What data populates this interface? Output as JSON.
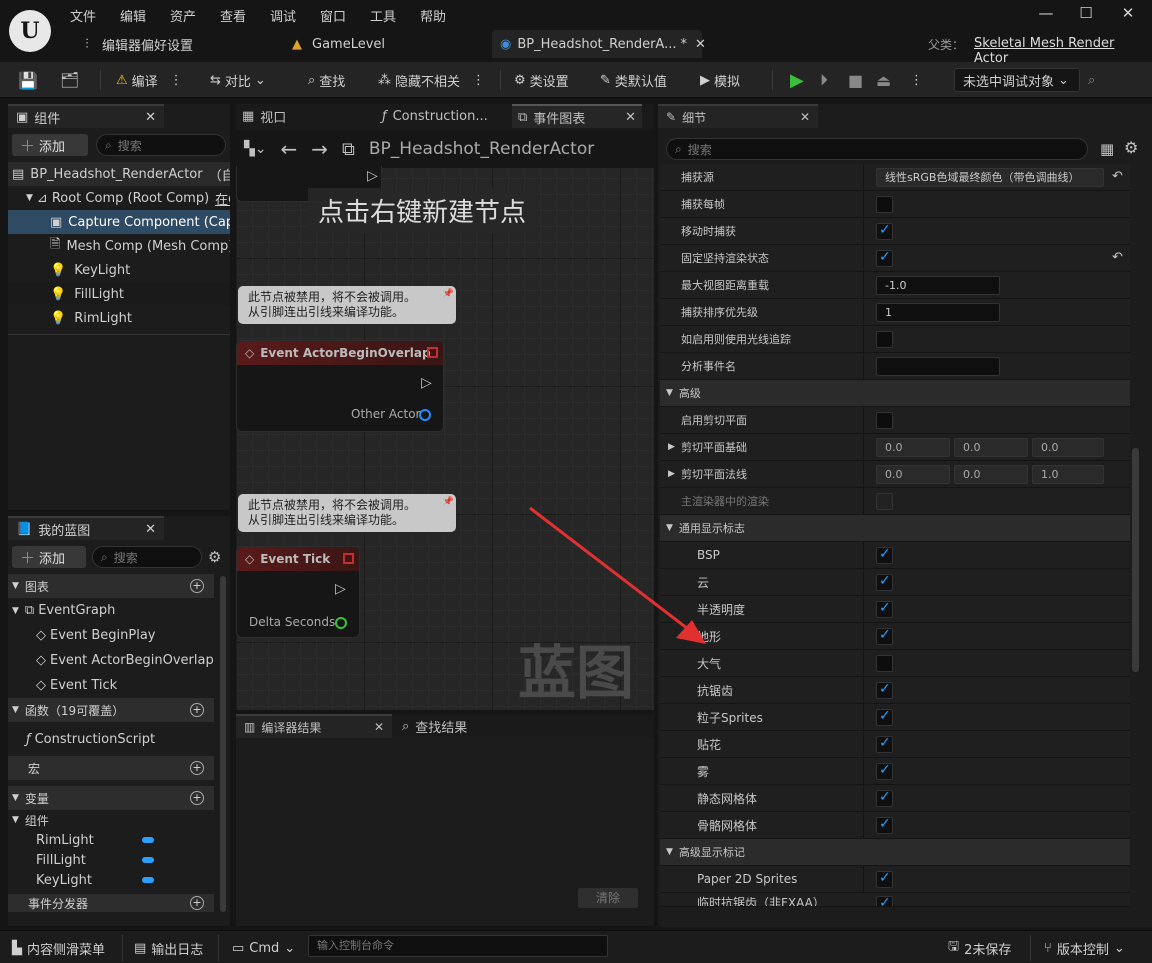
{
  "menu": [
    "文件",
    "编辑",
    "资产",
    "查看",
    "调试",
    "窗口",
    "工具",
    "帮助"
  ],
  "tabs": {
    "editor_prefs": "编辑器偏好设置",
    "game_level": "GameLevel",
    "blueprint": "BP_Headshot_RenderA...",
    "blueprint_dirty": "*",
    "parent_label": "父类：",
    "parent_class": "Skeletal Mesh Render Actor"
  },
  "toolbar": {
    "compile": "编译",
    "diff": "对比",
    "find": "查找",
    "hide_unrelated": "隐藏不相关",
    "class_settings": "类设置",
    "class_defaults": "类默认值",
    "simulate": "模拟",
    "debug_target": "未选中调试对象"
  },
  "components": {
    "title": "组件",
    "add": "添加",
    "search_placeholder": "搜索",
    "root_actor": "BP_Headshot_RenderActor",
    "root_actor_suffix": "（自",
    "root_comp": "Root Comp (Root Comp)",
    "root_comp_suffix": "在C",
    "items": [
      "Capture Component (Captu",
      "Mesh Comp (Mesh Comp)",
      "KeyLight",
      "FillLight",
      "RimLight"
    ]
  },
  "my_blueprint": {
    "title": "我的蓝图",
    "add": "添加",
    "search_placeholder": "搜索",
    "graphs_label": "图表",
    "event_graph": "EventGraph",
    "events": [
      "Event BeginPlay",
      "Event ActorBeginOverlap",
      "Event Tick"
    ],
    "functions_label": "函数（19可覆盖）",
    "construction_script": "ConstructionScript",
    "macros_label": "宏",
    "variables_label": "变量",
    "components_label": "组件",
    "variables": [
      "RimLight",
      "FillLight",
      "KeyLight"
    ],
    "dispatchers_label": "事件分发器"
  },
  "center_tabs": {
    "viewport": "视口",
    "construction": "Construction...",
    "event_graph": "事件图表"
  },
  "graph": {
    "breadcrumb": "BP_Headshot_RenderActor",
    "hint": "点击右键新建节点",
    "disabled_note_line1": "此节点被禁用，将不会被调用。",
    "disabled_note_line2": "从引脚连出引线来编译功能。",
    "node_overlap": "Event ActorBeginOverlap",
    "pin_other_actor": "Other Actor",
    "node_tick": "Event Tick",
    "pin_delta_seconds": "Delta Seconds",
    "watermark": "蓝图"
  },
  "compiler": {
    "tab_results": "编译器结果",
    "tab_find": "查找结果",
    "clear": "清除"
  },
  "details": {
    "title": "细节",
    "search_placeholder": "搜索",
    "rows": {
      "capture_source": "捕获源",
      "capture_source_value": "线性sRGB色域最终颜色（带色调曲线）",
      "capture_every_frame": "捕获每帧",
      "capture_on_move": "移动时捕获",
      "persist_render_state": "固定坚持渲染状态",
      "max_view_distance": "最大视图距离重载",
      "max_view_distance_value": "-1.0",
      "capture_sort_priority": "捕获排序优先级",
      "capture_sort_priority_value": "1",
      "use_raytracing": "如启用则使用光线追踪",
      "profiling_event_name": "分析事件名"
    },
    "advanced": "高级",
    "advanced_rows": {
      "enable_clip_plane": "启用剪切平面",
      "clip_plane_base": "剪切平面基础",
      "clip_plane_base_values": [
        "0.0",
        "0.0",
        "0.0"
      ],
      "clip_plane_normal": "剪切平面法线",
      "clip_plane_normal_values": [
        "0.0",
        "0.0",
        "1.0"
      ],
      "main_renderer": "主渲染器中的渲染"
    },
    "general_flags": "通用显示标志",
    "flags": [
      {
        "label": "BSP",
        "checked": true
      },
      {
        "label": "云",
        "checked": true
      },
      {
        "label": "半透明度",
        "checked": true
      },
      {
        "label": "地形",
        "checked": true
      },
      {
        "label": "大气",
        "checked": false
      },
      {
        "label": "抗锯齿",
        "checked": true
      },
      {
        "label": "粒子Sprites",
        "checked": true
      },
      {
        "label": "贴花",
        "checked": true
      },
      {
        "label": "雾",
        "checked": true
      },
      {
        "label": "静态网格体",
        "checked": true
      },
      {
        "label": "骨骼网格体",
        "checked": true
      }
    ],
    "advanced_flags": "高级显示标记",
    "paper2d": "Paper 2D Sprites",
    "temporal_aa": "临时抗锯齿（非FXAA）"
  },
  "statusbar": {
    "content_drawer": "内容侧滑菜单",
    "output_log": "输出日志",
    "cmd": "Cmd",
    "console_placeholder": "输入控制台命令",
    "unsaved": "2未保存",
    "source_control": "版本控制"
  },
  "colors": {
    "accent_blue": "#2aa0ff",
    "play_green": "#3cc03c",
    "selected_row": "#2f4a63",
    "annotation_red": "#e03030"
  }
}
